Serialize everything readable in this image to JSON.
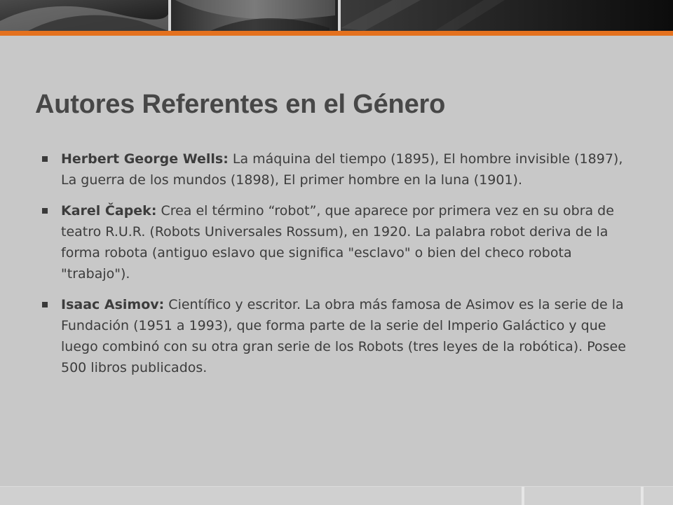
{
  "slide": {
    "title": "Autores Referentes en el Género",
    "bullets": [
      {
        "label": "Herbert George Wells:",
        "text": " La máquina del tiempo (1895), El hombre invisible (1897), La guerra de los mundos (1898), El primer hombre en la luna (1901)."
      },
      {
        "label": "Karel Čapek:",
        "text": " Crea el término “robot”, que aparece por primera vez en su obra de teatro R.U.R. (Robots Universales Rossum), en 1920. La palabra robot deriva de la forma robota (antiguo eslavo que significa \"esclavo\" o bien del checo robota \"trabajo\")."
      },
      {
        "label": "Isaac Asimov:",
        "text": " Científico y escritor. La obra más famosa de Asimov es la serie de la Fundación (1951 a 1993), que forma parte de la serie del Imperio Galáctico y que luego combinó con su otra gran serie de los Robots (tres leyes de la robótica). Posee 500 libros publicados."
      }
    ]
  },
  "theme": {
    "accent": "#e4711e",
    "background": "#c8c8c8",
    "title_color": "#474747",
    "text_color": "#3c3c3c",
    "header_color": "#1f1f1f"
  }
}
